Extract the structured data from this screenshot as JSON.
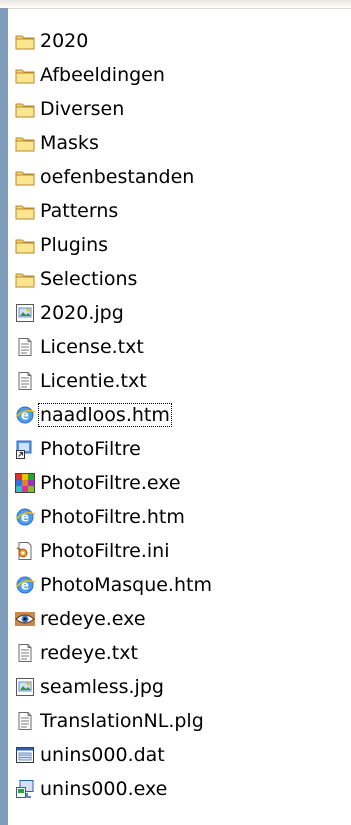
{
  "items": [
    {
      "label": "2020",
      "type": "folder",
      "icon": "folder-icon"
    },
    {
      "label": "Afbeeldingen",
      "type": "folder",
      "icon": "folder-icon"
    },
    {
      "label": "Diversen",
      "type": "folder",
      "icon": "folder-icon"
    },
    {
      "label": "Masks",
      "type": "folder",
      "icon": "folder-icon"
    },
    {
      "label": "oefenbestanden",
      "type": "folder",
      "icon": "folder-icon"
    },
    {
      "label": "Patterns",
      "type": "folder",
      "icon": "folder-icon"
    },
    {
      "label": "Plugins",
      "type": "folder",
      "icon": "folder-icon"
    },
    {
      "label": "Selections",
      "type": "folder",
      "icon": "folder-icon"
    },
    {
      "label": "2020.jpg",
      "type": "image",
      "icon": "image-file-icon"
    },
    {
      "label": "License.txt",
      "type": "text",
      "icon": "text-file-icon"
    },
    {
      "label": "Licentie.txt",
      "type": "text",
      "icon": "text-file-icon"
    },
    {
      "label": "naadloos.htm",
      "type": "html",
      "icon": "html-file-icon",
      "focused": true
    },
    {
      "label": "PhotoFiltre",
      "type": "shortcut",
      "icon": "shortcut-icon"
    },
    {
      "label": "PhotoFiltre.exe",
      "type": "exe",
      "icon": "photofiltre-app-icon"
    },
    {
      "label": "PhotoFiltre.htm",
      "type": "html",
      "icon": "html-file-icon"
    },
    {
      "label": "PhotoFiltre.ini",
      "type": "ini",
      "icon": "settings-file-icon"
    },
    {
      "label": "PhotoMasque.htm",
      "type": "html",
      "icon": "html-file-icon"
    },
    {
      "label": "redeye.exe",
      "type": "eye",
      "icon": "redeye-app-icon"
    },
    {
      "label": "redeye.txt",
      "type": "text",
      "icon": "text-file-icon"
    },
    {
      "label": "seamless.jpg",
      "type": "image",
      "icon": "image-file-icon"
    },
    {
      "label": "TranslationNL.plg",
      "type": "text",
      "icon": "text-file-icon"
    },
    {
      "label": "unins000.dat",
      "type": "dat",
      "icon": "data-file-icon"
    },
    {
      "label": "unins000.exe",
      "type": "installer",
      "icon": "uninstaller-icon"
    }
  ],
  "colors": {
    "folder_fill": "#f6d56a",
    "folder_stroke": "#b8892a",
    "ie_blue": "#2f6fd0",
    "edge_blue": "#7f9db9"
  }
}
